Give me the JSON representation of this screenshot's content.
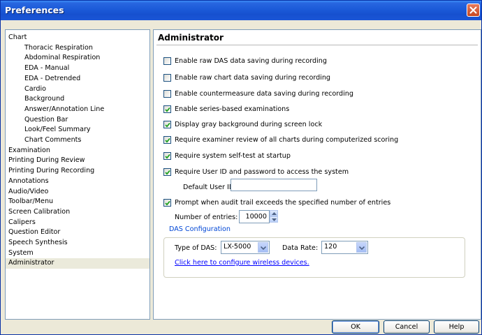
{
  "window": {
    "title": "Preferences"
  },
  "icons": {
    "close": "close-icon",
    "check": "checkmark-icon",
    "spin_up": "chevron-up-icon",
    "spin_down": "chevron-down-icon",
    "dropdown": "chevron-down-icon"
  },
  "colors": {
    "titlebar": "#1b5ad8",
    "close_button": "#d5572f",
    "link": "#0000ff",
    "group_label": "#0046d5",
    "selection": "#ebeadb"
  },
  "sidebar": {
    "items": [
      {
        "label": "Chart",
        "level": 0
      },
      {
        "label": "Thoracic Respiration",
        "level": 1
      },
      {
        "label": "Abdominal Respiration",
        "level": 1
      },
      {
        "label": "EDA - Manual",
        "level": 1
      },
      {
        "label": "EDA - Detrended",
        "level": 1
      },
      {
        "label": "Cardio",
        "level": 1
      },
      {
        "label": "Background",
        "level": 1
      },
      {
        "label": "Answer/Annotation Line",
        "level": 1
      },
      {
        "label": "Question Bar",
        "level": 1
      },
      {
        "label": "Look/Feel Summary",
        "level": 1
      },
      {
        "label": "Chart Comments",
        "level": 1
      },
      {
        "label": "Examination",
        "level": 0
      },
      {
        "label": "Printing During Review",
        "level": 0
      },
      {
        "label": "Printing During Recording",
        "level": 0
      },
      {
        "label": "Annotations",
        "level": 0
      },
      {
        "label": "Audio/Video",
        "level": 0
      },
      {
        "label": "Toolbar/Menu",
        "level": 0
      },
      {
        "label": "Screen Calibration",
        "level": 0
      },
      {
        "label": "Calipers",
        "level": 0
      },
      {
        "label": "Question Editor",
        "level": 0
      },
      {
        "label": "Speech Synthesis",
        "level": 0
      },
      {
        "label": "System",
        "level": 0
      },
      {
        "label": "Administrator",
        "level": 0,
        "selected": true
      }
    ]
  },
  "panel": {
    "title": "Administrator",
    "options": [
      {
        "label": "Enable raw DAS data saving during recording",
        "checked": false
      },
      {
        "label": "Enable raw chart data saving during recording",
        "checked": false
      },
      {
        "label": "Enable countermeasure data saving during recording",
        "checked": false
      },
      {
        "label": "Enable series-based examinations",
        "checked": true
      },
      {
        "label": "Display gray background during screen lock",
        "checked": true
      },
      {
        "label": "Require examiner review of all charts during computerized scoring",
        "checked": true
      },
      {
        "label": "Require system self-test at startup",
        "checked": true
      },
      {
        "label": "Require User ID and password to access the system",
        "checked": true
      },
      {
        "label": "Prompt when audit trail exceeds the specified number of entries",
        "checked": true
      }
    ],
    "default_user": {
      "label": "Default User ID:",
      "value": ""
    },
    "entries": {
      "label": "Number of entries:",
      "value": "10000"
    },
    "das": {
      "group_label": "DAS Configuration",
      "type_label": "Type of DAS:",
      "type_value": "LX-5000",
      "rate_label": "Data Rate:",
      "rate_value": "120",
      "link": "Click here to configure wireless devices."
    }
  },
  "buttons": {
    "ok": "OK",
    "cancel": "Cancel",
    "help": "Help"
  }
}
